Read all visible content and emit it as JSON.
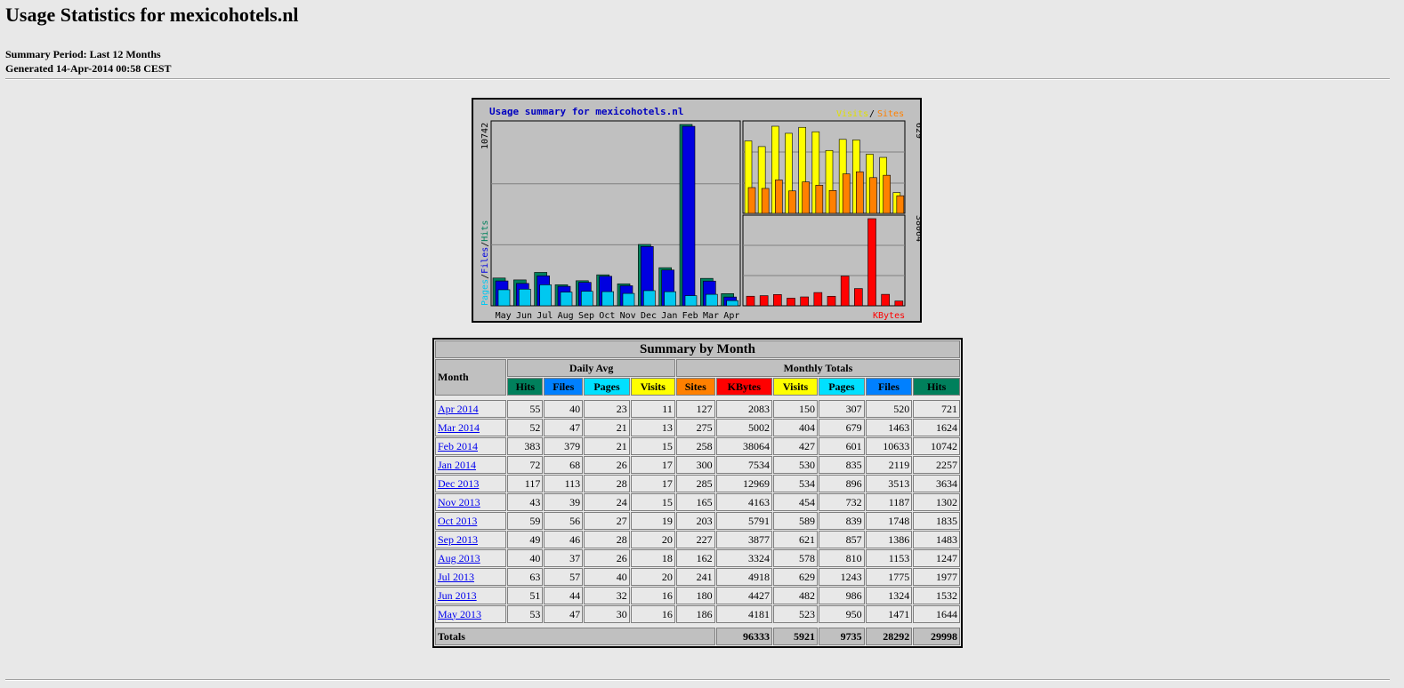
{
  "page": {
    "title": "Usage Statistics for mexicohotels.nl",
    "period": "Summary Period: Last 12 Months",
    "generated": "Generated 14-Apr-2014 00:58 CEST"
  },
  "chart_data": {
    "type": "bar",
    "title": "Usage summary for mexicohotels.nl",
    "categories": [
      "May",
      "Jun",
      "Jul",
      "Aug",
      "Sep",
      "Oct",
      "Nov",
      "Dec",
      "Jan",
      "Feb",
      "Mar",
      "Apr"
    ],
    "left_axis": {
      "max": 10742,
      "label_pages": "Pages",
      "label_files": "Files",
      "label_hits": "Hits",
      "sep": "/"
    },
    "top_right_axis": {
      "max": 629,
      "label_visits": "Visits",
      "label_sites": "Sites",
      "sep": "/"
    },
    "bottom_right_axis": {
      "max": 38064,
      "label": "KBytes"
    },
    "series": [
      {
        "name": "Hits",
        "color": "#00805c",
        "values": [
          1644,
          1532,
          1977,
          1247,
          1483,
          1835,
          1302,
          3634,
          2257,
          10742,
          1624,
          721
        ]
      },
      {
        "name": "Files",
        "color": "#0000e0",
        "values": [
          1471,
          1324,
          1775,
          1153,
          1386,
          1748,
          1187,
          3513,
          2119,
          10633,
          1463,
          520
        ]
      },
      {
        "name": "Pages",
        "color": "#00c8f0",
        "values": [
          950,
          986,
          1243,
          810,
          857,
          839,
          732,
          896,
          835,
          601,
          679,
          307
        ]
      },
      {
        "name": "Visits",
        "color": "#ffff00",
        "values": [
          523,
          482,
          629,
          578,
          621,
          589,
          454,
          534,
          530,
          427,
          404,
          150
        ]
      },
      {
        "name": "Sites",
        "color": "#ff8000",
        "values": [
          186,
          180,
          241,
          162,
          227,
          203,
          165,
          285,
          300,
          258,
          275,
          127
        ]
      },
      {
        "name": "KBytes",
        "color": "#ff0000",
        "values": [
          4181,
          4427,
          4918,
          3324,
          3877,
          5791,
          4163,
          12969,
          7534,
          38064,
          5002,
          2083
        ]
      }
    ]
  },
  "table": {
    "caption": "Summary by Month",
    "month_header": "Month",
    "daily_avg": "Daily Avg",
    "monthly_totals": "Monthly Totals",
    "daily_cols": [
      "Hits",
      "Files",
      "Pages",
      "Visits"
    ],
    "monthly_cols": [
      "Sites",
      "KBytes",
      "Visits",
      "Pages",
      "Files",
      "Hits"
    ],
    "rows": [
      {
        "month": "Apr 2014",
        "vals": [
          55,
          40,
          23,
          11,
          127,
          2083,
          150,
          307,
          520,
          721
        ]
      },
      {
        "month": "Mar 2014",
        "vals": [
          52,
          47,
          21,
          13,
          275,
          5002,
          404,
          679,
          1463,
          1624
        ]
      },
      {
        "month": "Feb 2014",
        "vals": [
          383,
          379,
          21,
          15,
          258,
          38064,
          427,
          601,
          10633,
          10742
        ]
      },
      {
        "month": "Jan 2014",
        "vals": [
          72,
          68,
          26,
          17,
          300,
          7534,
          530,
          835,
          2119,
          2257
        ]
      },
      {
        "month": "Dec 2013",
        "vals": [
          117,
          113,
          28,
          17,
          285,
          12969,
          534,
          896,
          3513,
          3634
        ]
      },
      {
        "month": "Nov 2013",
        "vals": [
          43,
          39,
          24,
          15,
          165,
          4163,
          454,
          732,
          1187,
          1302
        ]
      },
      {
        "month": "Oct 2013",
        "vals": [
          59,
          56,
          27,
          19,
          203,
          5791,
          589,
          839,
          1748,
          1835
        ]
      },
      {
        "month": "Sep 2013",
        "vals": [
          49,
          46,
          28,
          20,
          227,
          3877,
          621,
          857,
          1386,
          1483
        ]
      },
      {
        "month": "Aug 2013",
        "vals": [
          40,
          37,
          26,
          18,
          162,
          3324,
          578,
          810,
          1153,
          1247
        ]
      },
      {
        "month": "Jul 2013",
        "vals": [
          63,
          57,
          40,
          20,
          241,
          4918,
          629,
          1243,
          1775,
          1977
        ]
      },
      {
        "month": "Jun 2013",
        "vals": [
          51,
          44,
          32,
          16,
          180,
          4427,
          482,
          986,
          1324,
          1532
        ]
      },
      {
        "month": "May 2013",
        "vals": [
          53,
          47,
          30,
          16,
          186,
          4181,
          523,
          950,
          1471,
          1644
        ]
      }
    ],
    "totals": {
      "label": "Totals",
      "vals": [
        96333,
        5921,
        9735,
        28292,
        29998
      ]
    }
  }
}
